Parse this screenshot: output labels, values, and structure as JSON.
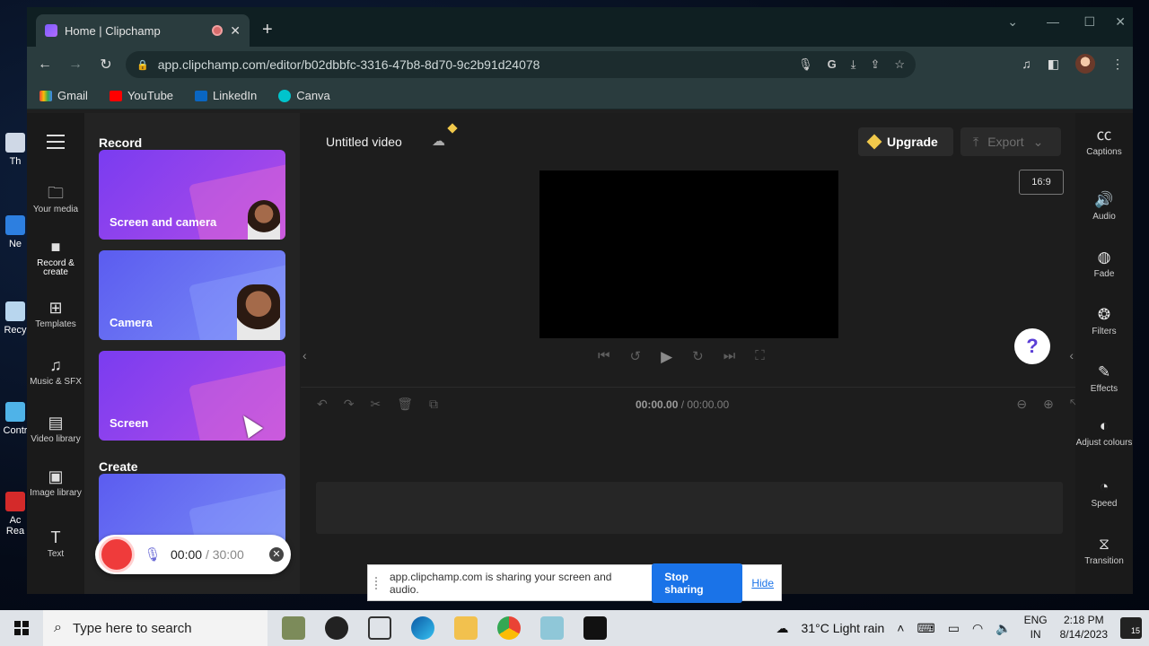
{
  "desktop": {
    "icons": [
      {
        "label": "Th",
        "top": 0
      },
      {
        "label": "Ne",
        "top": 0
      },
      {
        "label": "Recy",
        "top": 0
      },
      {
        "label": "Contr",
        "top": 0
      },
      {
        "label": "Ac Rea",
        "top": 0
      }
    ]
  },
  "browser": {
    "tab_title": "Home | Clipchamp",
    "url": "app.clipchamp.com/editor/b02dbbfc-3316-47b8-8d70-9c2b91d24078",
    "bookmarks": [
      "Gmail",
      "YouTube",
      "LinkedIn",
      "Canva"
    ]
  },
  "leftnav": {
    "items": [
      {
        "label": "Your media",
        "icon": "folder-icon"
      },
      {
        "label": "Record & create",
        "icon": "camera-icon"
      },
      {
        "label": "Templates",
        "icon": "templates-icon"
      },
      {
        "label": "Music & SFX",
        "icon": "music-icon"
      },
      {
        "label": "Video library",
        "icon": "film-icon"
      },
      {
        "label": "Image library",
        "icon": "image-icon"
      },
      {
        "label": "Text",
        "icon": "text-icon"
      }
    ]
  },
  "panel": {
    "record_heading": "Record",
    "create_heading": "Create",
    "cards": [
      "Screen and camera",
      "Camera",
      "Screen"
    ]
  },
  "recorder": {
    "elapsed": "00:00",
    "separator": "/",
    "limit": "30:00"
  },
  "editor": {
    "title": "Untitled video",
    "upgrade_label": "Upgrade",
    "export_label": "Export",
    "aspect_ratio": "16:9",
    "help_label": "?",
    "time_current": "00:00.00",
    "time_separator": "/",
    "time_total": "00:00.00"
  },
  "rightnav": {
    "items": [
      {
        "label": "Captions",
        "icon": "captions-icon"
      },
      {
        "label": "Audio",
        "icon": "speaker-icon"
      },
      {
        "label": "Fade",
        "icon": "fade-icon"
      },
      {
        "label": "Filters",
        "icon": "filters-icon"
      },
      {
        "label": "Effects",
        "icon": "magic-wand-icon"
      },
      {
        "label": "Adjust colours",
        "icon": "contrast-icon"
      },
      {
        "label": "Speed",
        "icon": "speedometer-icon"
      },
      {
        "label": "Transition",
        "icon": "transition-icon"
      }
    ]
  },
  "sharing": {
    "message": "app.clipchamp.com is sharing your screen and audio.",
    "stop_label": "Stop sharing",
    "hide_label": "Hide"
  },
  "taskbar": {
    "search_placeholder": "Type here to search",
    "weather": "31°C  Light rain",
    "lang_top": "ENG",
    "lang_bottom": "IN",
    "time": "2:18 PM",
    "date": "8/14/2023",
    "notifications": "15"
  },
  "colors": {
    "accent": "#7b5cff",
    "record": "#ef3b3b",
    "share_button": "#1a73e8",
    "upgrade_gem": "#f1c94b"
  }
}
